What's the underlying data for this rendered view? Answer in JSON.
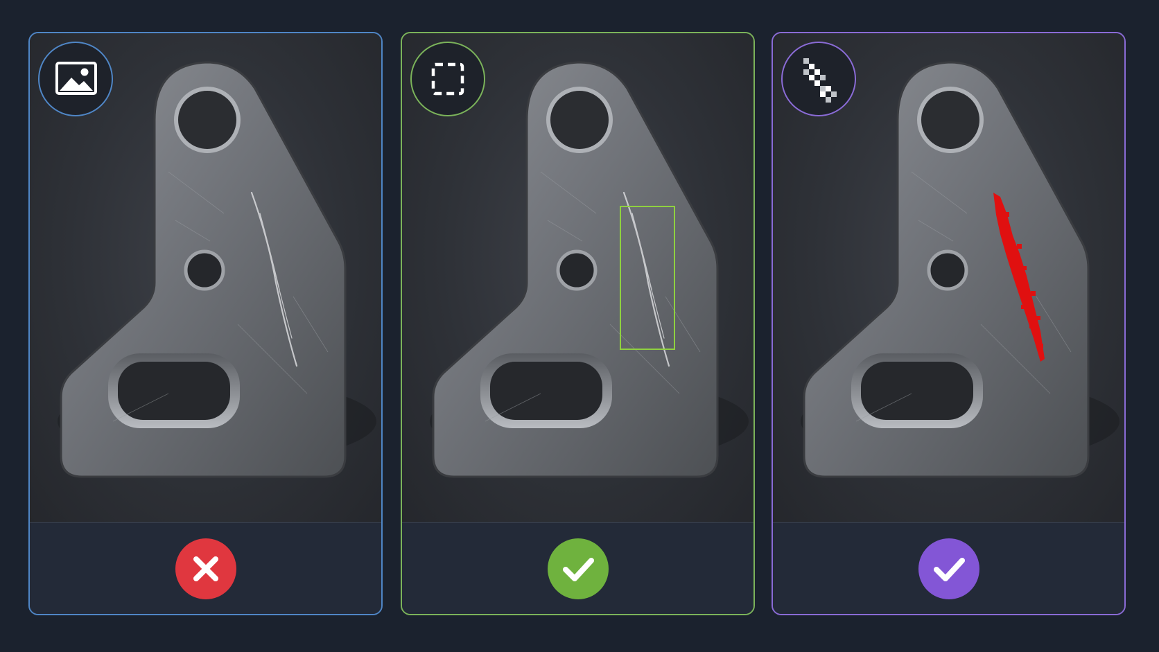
{
  "colors": {
    "background": "#1b222e",
    "panel_1_accent": "#4f86c6",
    "panel_2_accent": "#7bb35a",
    "panel_3_accent": "#8a6bd6",
    "fail_red": "#e0373f",
    "pass_green": "#6fb23e",
    "pass_purple": "#8356d6",
    "mask_red": "#e01010",
    "box_green": "#8fd140"
  },
  "panels": [
    {
      "mode_icon": "image-icon",
      "result_icon": "x-icon",
      "result": "fail"
    },
    {
      "mode_icon": "bounding-box-icon",
      "result_icon": "check-icon",
      "result": "pass"
    },
    {
      "mode_icon": "pixel-mask-icon",
      "result_icon": "check-icon",
      "result": "pass"
    }
  ]
}
